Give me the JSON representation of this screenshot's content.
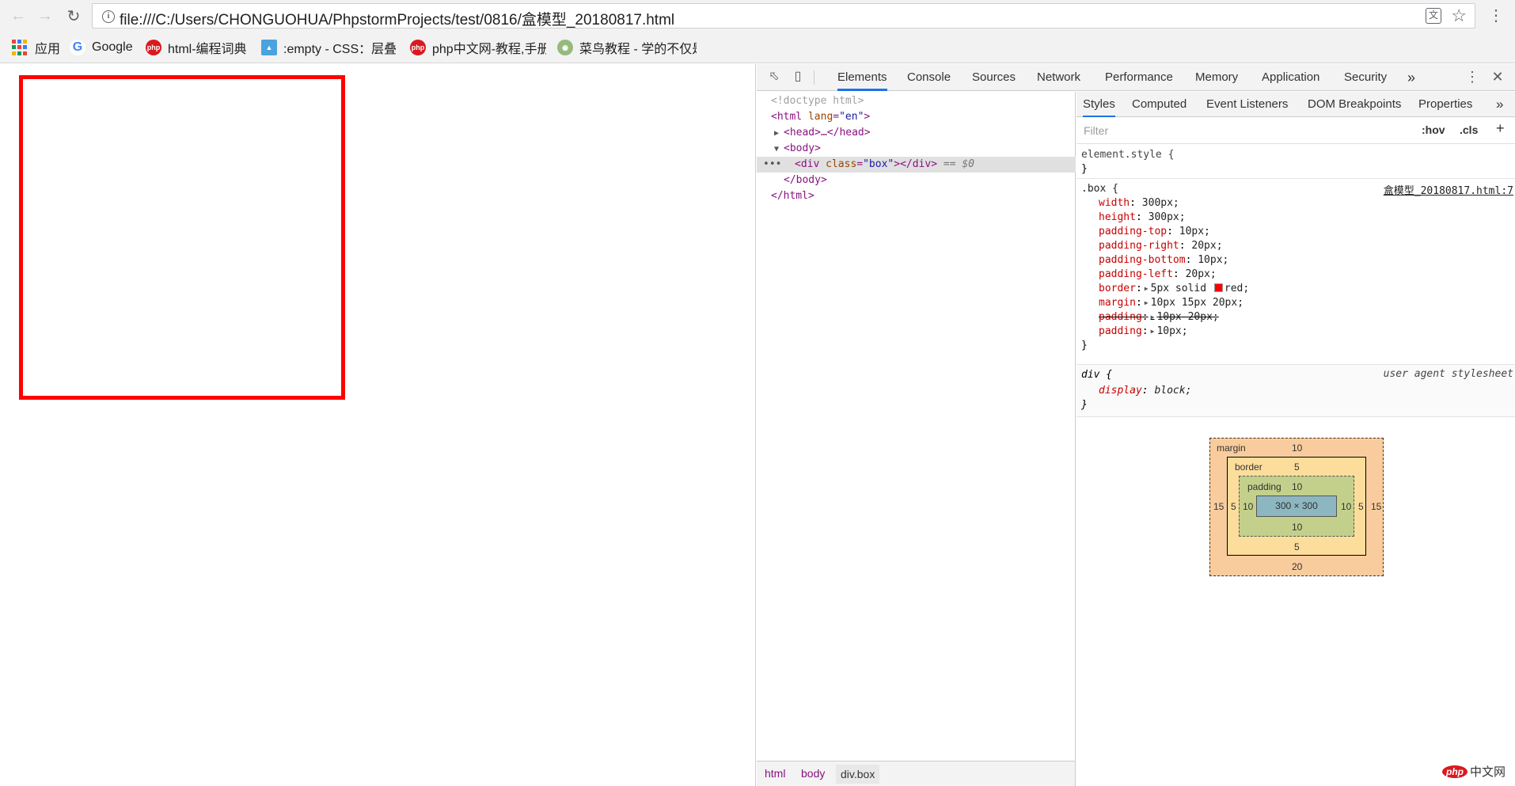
{
  "browser": {
    "url": "file:///C:/Users/CHONGUOHUA/PhpstormProjects/test/0816/盒模型_20180817.html",
    "bookmarks": [
      {
        "label": "应用",
        "icon": "apps-grid-icon"
      },
      {
        "label": "Google",
        "icon": "google-icon"
      },
      {
        "label": "html-编程词典",
        "icon": "php-icon"
      },
      {
        "label": ":empty - CSS：层叠",
        "icon": "mdn-icon"
      },
      {
        "label": "php中文网-教程,手册",
        "icon": "php-icon"
      },
      {
        "label": "菜鸟教程 - 学的不仅是",
        "icon": "runoob-icon"
      }
    ]
  },
  "devtools": {
    "tabs": [
      "Elements",
      "Console",
      "Sources",
      "Network",
      "Performance",
      "Memory",
      "Application",
      "Security"
    ],
    "active_tab": "Elements",
    "more": "»",
    "dom": {
      "doctype": "<!doctype html>",
      "html_open_tag": "html",
      "html_attr": "lang",
      "html_attr_val": "\"en\"",
      "head": "<head>…</head>",
      "body_open": "<body>",
      "div_tag": "div",
      "div_attr": "class",
      "div_attr_val": "\"box\"",
      "div_close": "></div>",
      "selected_marker": "== $0",
      "body_close": "</body>",
      "html_close": "</html>",
      "dots": "•••"
    },
    "breadcrumbs": [
      "html",
      "body",
      "div.box"
    ],
    "styles_tabs": [
      "Styles",
      "Computed",
      "Event Listeners",
      "DOM Breakpoints",
      "Properties"
    ],
    "filter_placeholder": "Filter",
    "hov": ":hov",
    "cls": ".cls",
    "add": "+",
    "rules": {
      "element_style": {
        "selector": "element.style {",
        "close": "}"
      },
      "box": {
        "selector": ".box {",
        "source": "盒模型_20180817.html:7",
        "props": [
          {
            "name": "width",
            "value": "300px;"
          },
          {
            "name": "height",
            "value": "300px;"
          },
          {
            "name": "padding-top",
            "value": "10px;"
          },
          {
            "name": "padding-right",
            "value": "20px;"
          },
          {
            "name": "padding-bottom",
            "value": "10px;"
          },
          {
            "name": "padding-left",
            "value": "20px;"
          },
          {
            "name": "border",
            "value": "5px solid",
            "value2": "red;"
          },
          {
            "name": "margin",
            "value": "10px 15px 20px;"
          },
          {
            "name": "padding",
            "value": "10px 20px;"
          },
          {
            "name": "padding",
            "value": "10px;"
          }
        ],
        "close": "}"
      },
      "div": {
        "selector": "div {",
        "source": "user agent stylesheet",
        "prop_name": "display",
        "prop_value": "block;",
        "close": "}"
      }
    },
    "box_model": {
      "margin_label": "margin",
      "margin_top": "10",
      "margin_right": "15",
      "margin_bottom": "20",
      "margin_left": "15",
      "border_label": "border",
      "border_top": "5",
      "border_right": "5",
      "border_bottom": "5",
      "border_left": "5",
      "padding_label": "padding",
      "padding_top": "10",
      "padding_right": "10",
      "padding_bottom": "10",
      "padding_left": "10",
      "content": "300 × 300"
    }
  },
  "watermark": {
    "logo": "php",
    "text": "中文网"
  },
  "colors": {
    "accent": "#1a73e8",
    "box_border": "#ff0000"
  }
}
